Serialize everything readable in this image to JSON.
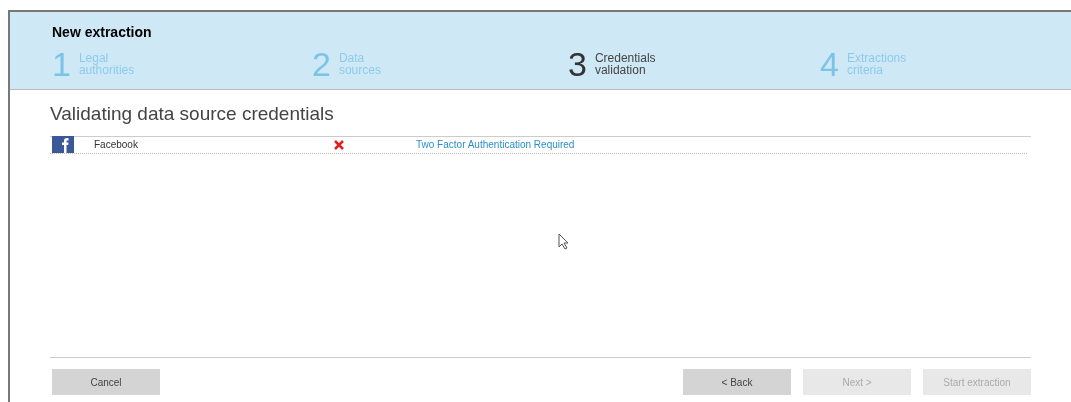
{
  "window": {
    "title": "New extraction"
  },
  "steps": [
    {
      "number": "1",
      "label": [
        "Legal",
        "authorities"
      ],
      "active": false
    },
    {
      "number": "2",
      "label": [
        "Data",
        "sources"
      ],
      "active": false
    },
    {
      "number": "3",
      "label": [
        "Credentials",
        "validation"
      ],
      "active": true
    },
    {
      "number": "4",
      "label": [
        "Extractions",
        "criteria"
      ],
      "active": false
    }
  ],
  "heading": "Validating data source credentials",
  "sources": [
    {
      "name": "Facebook",
      "valid": false,
      "status": "Two Factor Authentication Required"
    }
  ],
  "buttons": [
    {
      "label": "Cancel",
      "disabled": false
    },
    {
      "label": "< Back",
      "disabled": false
    },
    {
      "label": "Next >",
      "disabled": true
    },
    {
      "label": "Start extraction",
      "disabled": true
    }
  ]
}
